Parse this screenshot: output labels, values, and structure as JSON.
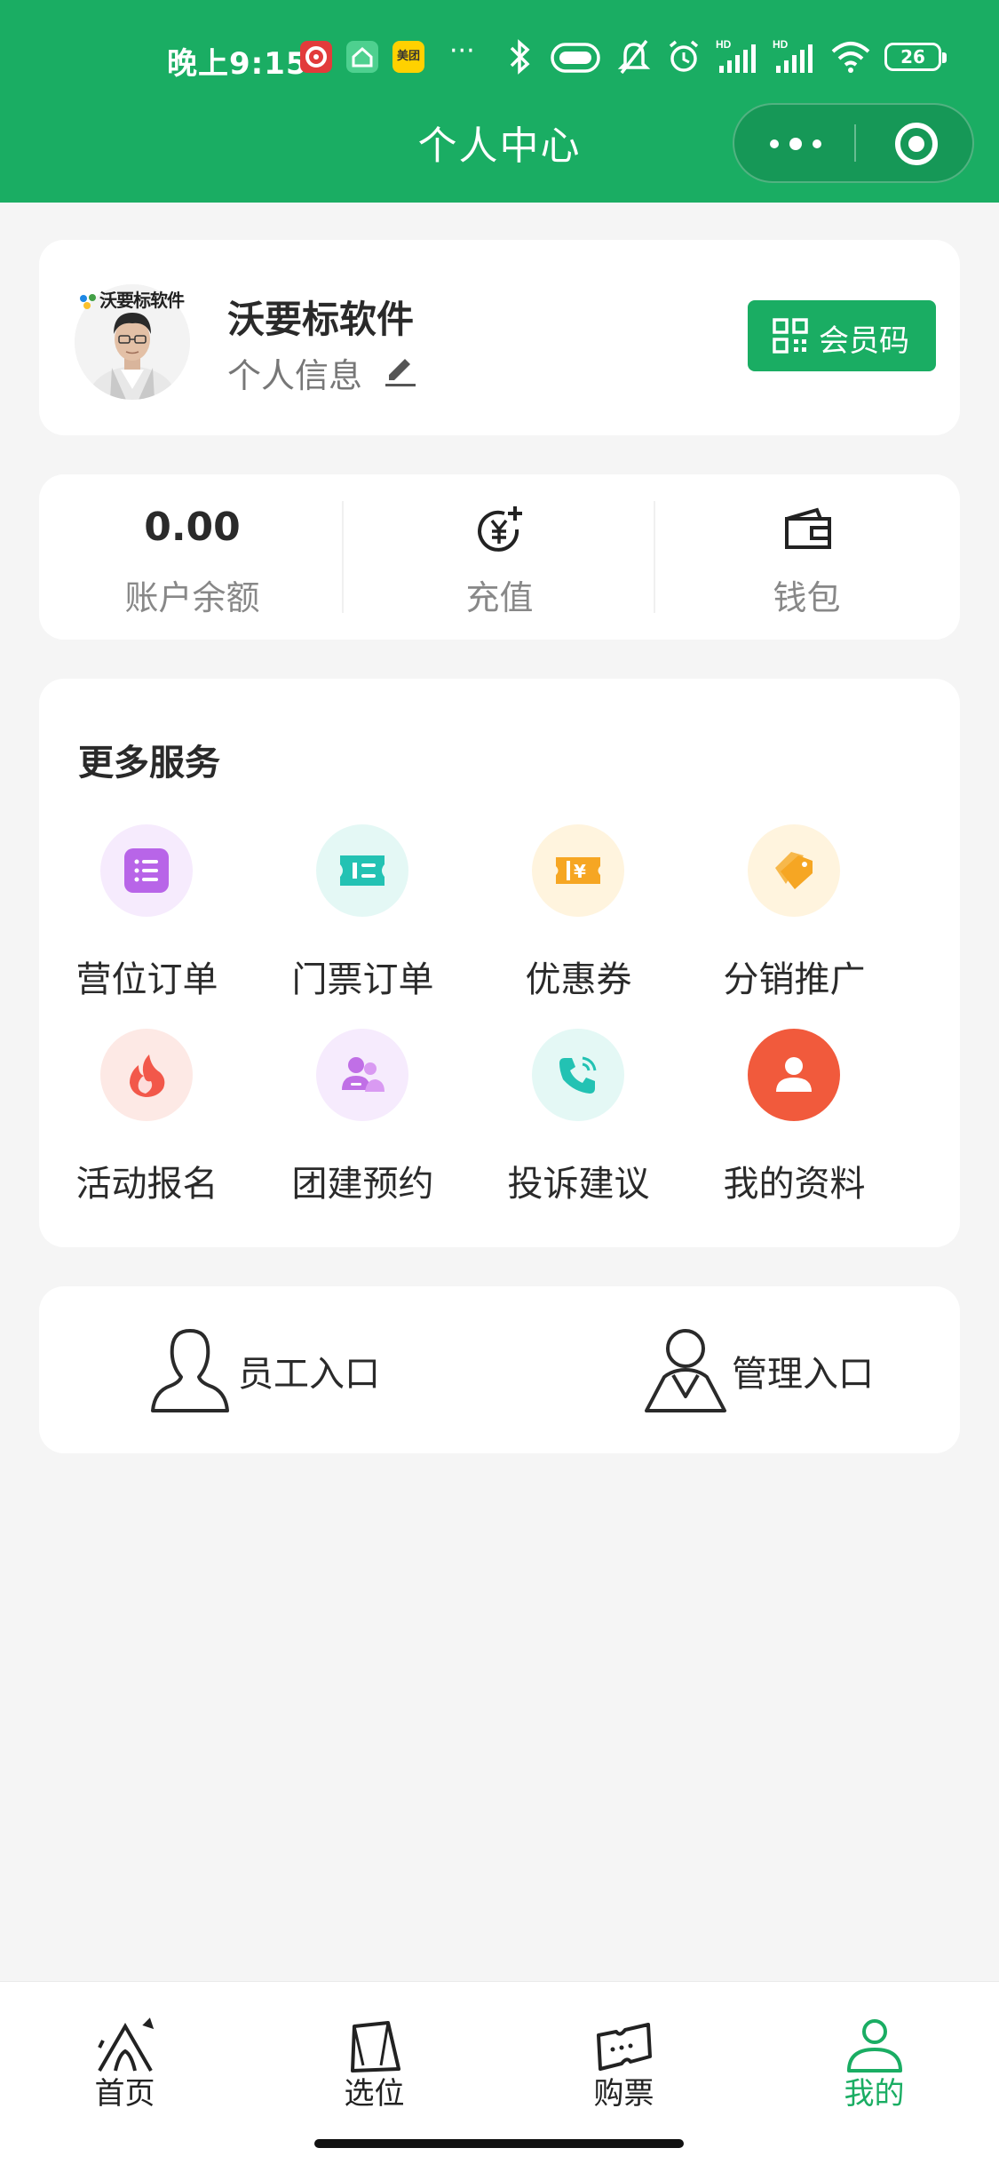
{
  "status_bar": {
    "time": "晚上9:15",
    "app_badges": [
      "",
      "",
      "美团"
    ],
    "more": "···",
    "battery": "26"
  },
  "header": {
    "title": "个人中心"
  },
  "profile": {
    "logo_text": "沃要标软件",
    "name": "沃要标软件",
    "info_label": "个人信息",
    "member_code_label": "会员码"
  },
  "stats": [
    {
      "value": "0.00",
      "label": "账户余额"
    },
    {
      "label": "充值",
      "icon": "yuan-plus-icon"
    },
    {
      "label": "钱包",
      "icon": "wallet-icon"
    }
  ],
  "services": {
    "title": "更多服务",
    "items": [
      {
        "label": "营位订单",
        "icon": "list-icon",
        "color": "#b865e8"
      },
      {
        "label": "门票订单",
        "icon": "ticket-icon",
        "color": "#23c2b3"
      },
      {
        "label": "优惠券",
        "icon": "coupon-icon",
        "color": "#f6a623"
      },
      {
        "label": "分销推广",
        "icon": "tag-icon",
        "color": "#f6a623"
      },
      {
        "label": "活动报名",
        "icon": "flame-icon",
        "color": "#f2584a"
      },
      {
        "label": "团建预约",
        "icon": "group-icon",
        "color": "#c06fe6"
      },
      {
        "label": "投诉建议",
        "icon": "phone-icon",
        "color": "#23c2b3"
      },
      {
        "label": "我的资料",
        "icon": "user-icon",
        "color": "#f15a3c"
      }
    ]
  },
  "entries": [
    {
      "label": "员工入口",
      "icon": "staff-icon"
    },
    {
      "label": "管理入口",
      "icon": "manager-icon"
    }
  ],
  "tabbar": [
    {
      "label": "首页",
      "icon": "tent-icon",
      "active": false
    },
    {
      "label": "选位",
      "icon": "bag-icon",
      "active": false
    },
    {
      "label": "购票",
      "icon": "ticket-tab-icon",
      "active": false
    },
    {
      "label": "我的",
      "icon": "person-tab-icon",
      "active": true
    }
  ],
  "colors": {
    "brand": "#1aad63",
    "background": "#f5f5f5"
  }
}
